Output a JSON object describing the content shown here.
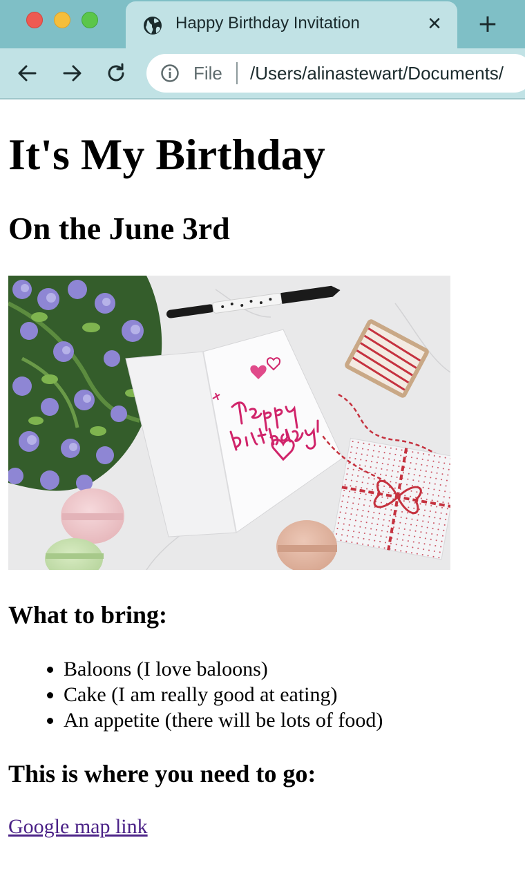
{
  "browser": {
    "tab_title": "Happy Birthday Invitation",
    "tab_icon": "globe-icon",
    "close_icon": "close-icon",
    "new_tab_icon": "plus-icon",
    "address": {
      "scheme_label": "File",
      "url": "/Users/alinastewart/Documents/"
    },
    "colors": {
      "tab_bar": "#7fbfc6",
      "active_tab": "#c1e2e5"
    }
  },
  "page": {
    "title": "It's My Birthday",
    "subtitle": "On the June 3rd",
    "image_alt": "",
    "bring_heading": "What to bring:",
    "bring_items": [
      "Baloons (I love baloons)",
      "Cake (I am really good at eating)",
      "An appetite (there will be lots of food)"
    ],
    "where_heading": "This is where you need to go:",
    "map_link_label": "Google map link",
    "link_color": "#4b2287"
  }
}
